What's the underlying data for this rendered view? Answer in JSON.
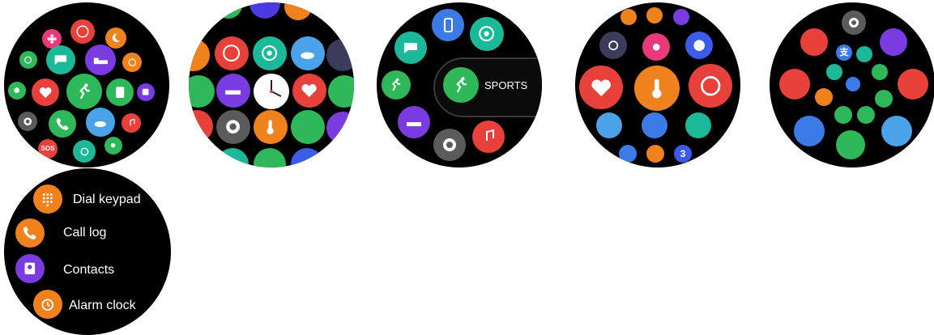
{
  "colors": {
    "red": "#e8403a",
    "green": "#2fb85a",
    "teal": "#1cb89a",
    "blue": "#3b7be8",
    "purple": "#7a3be0",
    "orange": "#f0821e",
    "gray": "#5b5b5b",
    "pink": "#e83a7a",
    "lightblue": "#4aa3e8"
  },
  "watch3": {
    "sports_label": "SPORTS"
  },
  "watch4": {
    "count_badge": "3"
  },
  "watch1": {
    "sos_label": "SOS"
  },
  "watch5": {
    "alipay_glyph": "支"
  },
  "list_menu": {
    "items": [
      {
        "label": "Dial keypad",
        "icon": "keypad-icon"
      },
      {
        "label": "Call log",
        "icon": "call-log-icon"
      },
      {
        "label": "Contacts",
        "icon": "contacts-icon"
      },
      {
        "label": "Alarm clock",
        "icon": "alarm-clock-icon"
      }
    ]
  }
}
